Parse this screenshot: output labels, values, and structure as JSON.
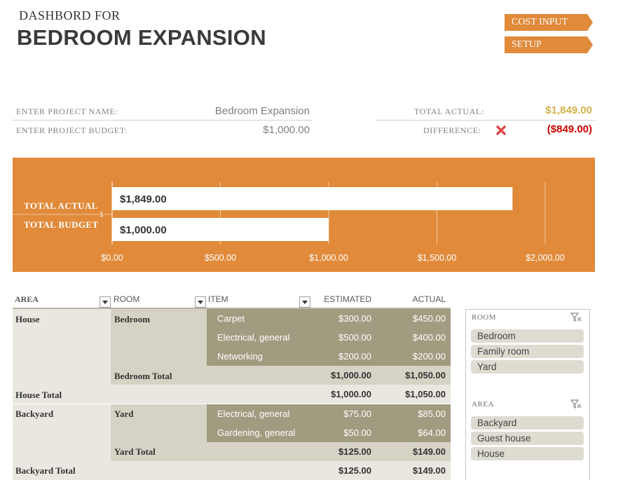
{
  "header": {
    "subtitle": "DASHBORD FOR",
    "title": "BEDROOM EXPANSION"
  },
  "nav": {
    "cost_input_label": "COST INPUT",
    "setup_label": "SETUP"
  },
  "info": {
    "project_name_label": "ENTER PROJECT NAME:",
    "project_name_value": "Bedroom Expansion",
    "project_budget_label": "ENTER PROJECT BUDGET:",
    "project_budget_value": "$1,000.00",
    "total_actual_label": "TOTAL ACTUAL:",
    "total_actual_value": "$1,849.00",
    "difference_label": "DIFFERENCE:",
    "difference_value": "($849.00)",
    "difference_icon": "red-x-icon",
    "colors": {
      "actual": "#d4b24a",
      "difference": "#cc0000"
    }
  },
  "chart_data": {
    "type": "bar",
    "orientation": "horizontal",
    "categories": [
      "TOTAL ACTUAL",
      "TOTAL BUDGET"
    ],
    "values": [
      1849,
      1000
    ],
    "data_labels": [
      "$1,849.00",
      "$1,000.00"
    ],
    "axis_tick_label": "1",
    "xlim": [
      0,
      2000
    ],
    "xticks": [
      "$0.00",
      "$500.00",
      "$1,000.00",
      "$1,500.00",
      "$2,000.00"
    ],
    "xtick_values": [
      0,
      500,
      1000,
      1500,
      2000
    ],
    "grid": true,
    "background": "#e08a3a",
    "bar_color": "#ffffff"
  },
  "table": {
    "headers": {
      "area": "AREA",
      "room": "ROOM",
      "item": "ITEM",
      "estimated": "ESTIMATED",
      "actual": "ACTUAL"
    },
    "rows": [
      {
        "area": "House",
        "room": "Bedroom",
        "item": "Carpet",
        "estimated": "$300.00",
        "actual": "$450.00"
      },
      {
        "item": "Electrical, general",
        "estimated": "$500.00",
        "actual": "$400.00"
      },
      {
        "item": "Networking",
        "estimated": "$200.00",
        "actual": "$200.00"
      },
      {
        "room": "Bedroom Total",
        "estimated": "$1,000.00",
        "actual": "$1,050.00"
      },
      {
        "area": "House Total",
        "estimated": "$1,000.00",
        "actual": "$1,050.00"
      },
      {
        "area": "Backyard",
        "room": "Yard",
        "item": "Electrical, general",
        "estimated": "$75.00",
        "actual": "$85.00"
      },
      {
        "item": "Gardening, general",
        "estimated": "$50.00",
        "actual": "$64.00"
      },
      {
        "room": "Yard Total",
        "estimated": "$125.00",
        "actual": "$149.00"
      },
      {
        "area": "Backyard Total",
        "estimated": "$125.00",
        "actual": "$149.00"
      }
    ]
  },
  "slicers": {
    "room": {
      "title": "ROOM",
      "items": [
        "Bedroom",
        "Family room",
        "Yard"
      ]
    },
    "area": {
      "title": "AREA",
      "items": [
        "Backyard",
        "Guest house",
        "House"
      ]
    },
    "clear_icon": "clear-filter-icon"
  }
}
